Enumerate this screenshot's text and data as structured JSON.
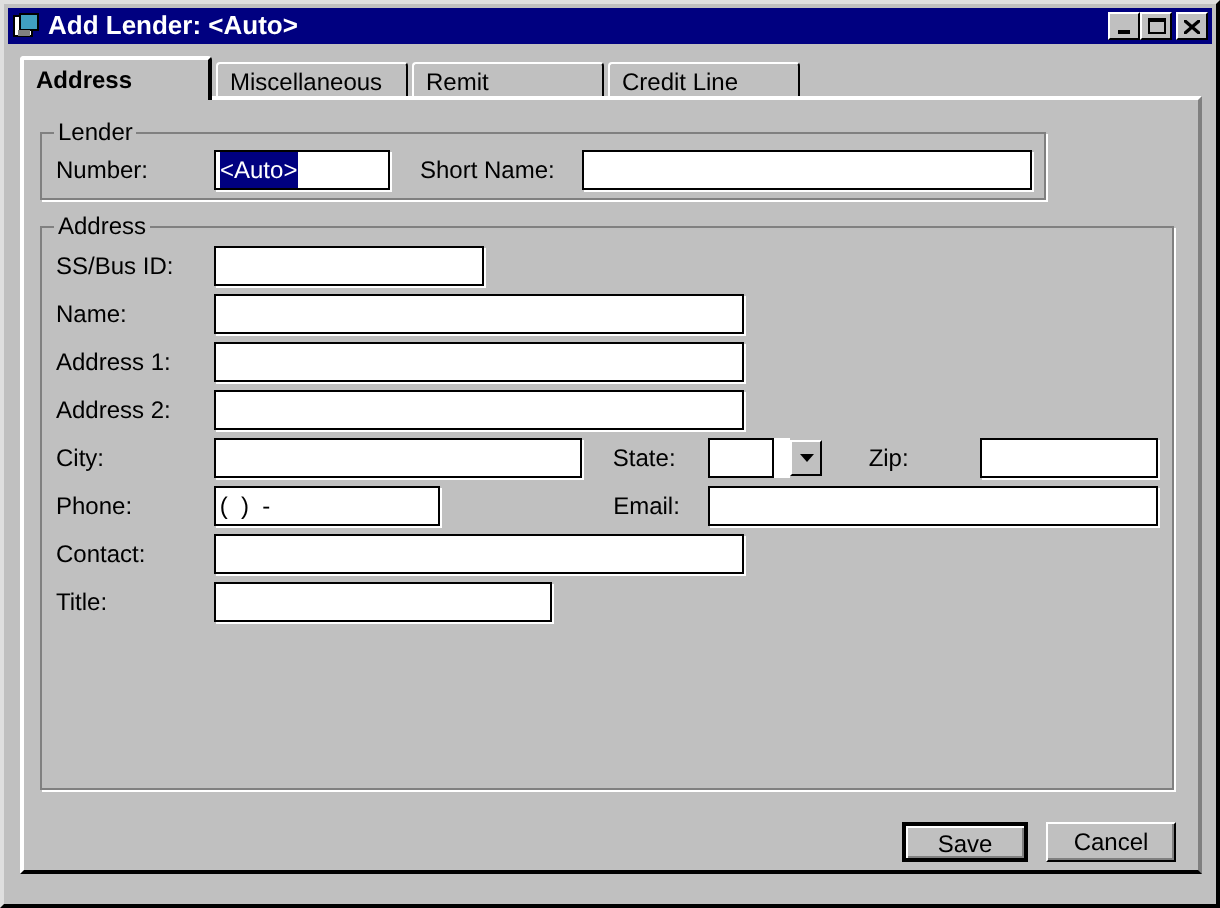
{
  "window": {
    "title": "Add Lender: <Auto>"
  },
  "tabs": [
    {
      "label": "Address",
      "selected": true
    },
    {
      "label": "Miscellaneous",
      "selected": false
    },
    {
      "label": "Remit",
      "selected": false
    },
    {
      "label": "Credit Line",
      "selected": false
    }
  ],
  "lender_group": {
    "title": "Lender",
    "fields": [
      {
        "label": "Number:",
        "value": "<Auto>",
        "selected": true
      },
      {
        "label": "Short Name:"
      }
    ]
  },
  "address_group": {
    "title": "Address",
    "rows": [
      [
        {
          "kind": "text",
          "label": "SS/Bus ID:"
        }
      ],
      [
        {
          "kind": "text",
          "label": "Name:"
        }
      ],
      [
        {
          "kind": "text",
          "label": "Address 1:"
        }
      ],
      [
        {
          "kind": "text",
          "label": "Address 2:"
        }
      ],
      [
        {
          "kind": "text",
          "label": "City:"
        },
        {
          "kind": "dropdown",
          "label": "State:"
        },
        {
          "kind": "text",
          "label": "Zip:"
        }
      ],
      [
        {
          "kind": "text",
          "label": "Phone:",
          "value": "(  )  -"
        },
        {
          "kind": "text",
          "label": "Email:"
        }
      ],
      [
        {
          "kind": "text",
          "label": "Contact:"
        }
      ],
      [
        {
          "kind": "text",
          "label": "Title:"
        }
      ]
    ]
  },
  "buttons": [
    {
      "label": "Save",
      "default": true
    },
    {
      "label": "Cancel",
      "default": false
    }
  ]
}
